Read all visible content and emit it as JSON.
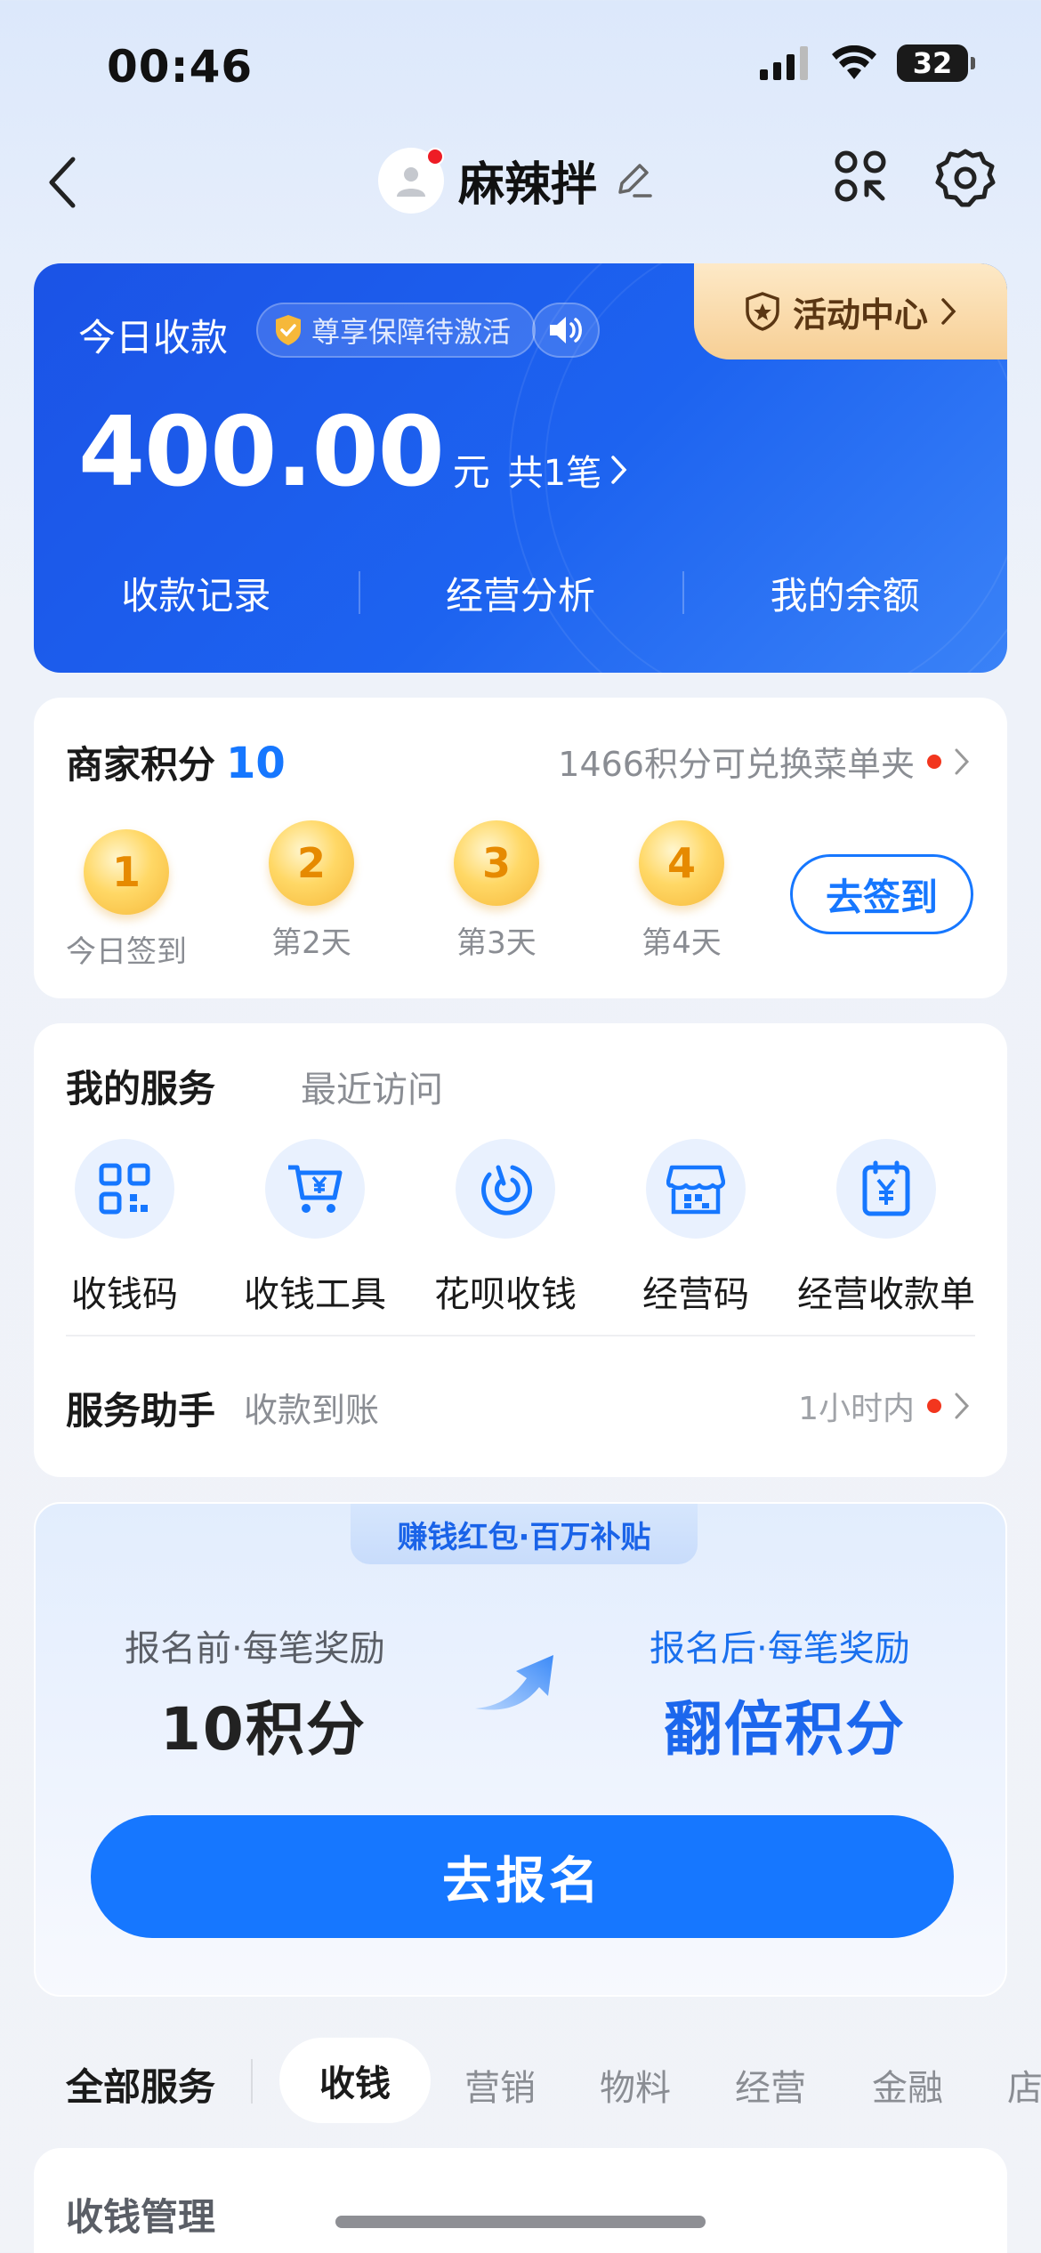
{
  "status_bar": {
    "time": "00:46",
    "battery": "32"
  },
  "header": {
    "shop_name": "麻辣拌"
  },
  "income_card": {
    "today_label": "今日收款",
    "badge": "尊享保障待激活",
    "activity_center": "活动中心",
    "amount": "400.00",
    "unit": "元",
    "count": "共1笔",
    "links": [
      "收款记录",
      "经营分析",
      "我的余额"
    ]
  },
  "points": {
    "title": "商家积分",
    "value": "10",
    "exchange_text": "1466积分可兑换菜单夹",
    "days": [
      {
        "num": "1",
        "label": "今日签到"
      },
      {
        "num": "2",
        "label": "第2天"
      },
      {
        "num": "3",
        "label": "第3天"
      },
      {
        "num": "4",
        "label": "第4天"
      }
    ],
    "signin_button": "去签到"
  },
  "services": {
    "tab_active": "我的服务",
    "tab_recent": "最近访问",
    "items": [
      {
        "label": "收钱码",
        "icon": "qr-grid-icon"
      },
      {
        "label": "收钱工具",
        "icon": "cart-yuan-icon"
      },
      {
        "label": "花呗收钱",
        "icon": "huabei-icon"
      },
      {
        "label": "经营码",
        "icon": "store-qr-icon"
      },
      {
        "label": "经营收款单",
        "icon": "receipt-yuan-icon"
      }
    ],
    "helper_title": "服务助手",
    "helper_sub": "收款到账",
    "helper_time": "1小时内"
  },
  "promo": {
    "tag": "赚钱红包·百万补贴",
    "before_label": "报名前·每笔奖励",
    "before_value": "10积分",
    "after_label": "报名后·每笔奖励",
    "after_value": "翻倍积分",
    "button": "去报名"
  },
  "categories": {
    "title": "全部服务",
    "items": [
      "收钱",
      "营销",
      "物料",
      "经营",
      "金融",
      "店"
    ]
  },
  "bottom_section": {
    "title": "收钱管理"
  },
  "colors": {
    "brand_blue": "#1677ff",
    "card_blue": "#1b53e6",
    "red_dot": "#f2361e",
    "gold": "#f6b83a"
  }
}
